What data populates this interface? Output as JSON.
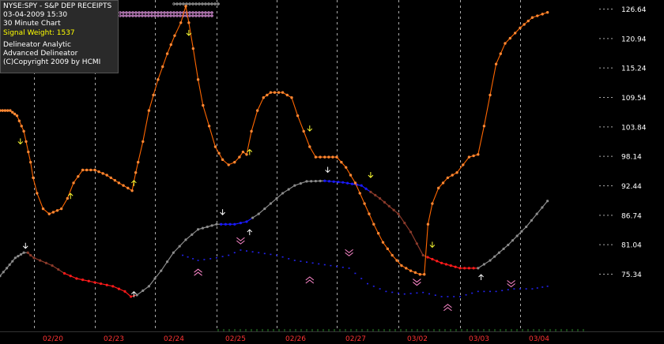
{
  "info_box": {
    "symbol_line": "NYSE:SPY - S&P DEP RECEIPTS",
    "datetime_line": "03-04-2009 15:30",
    "interval_line": "30 Minute Chart",
    "signal_line": "Signal Weight: 1537",
    "study_1": "Delineator Analytic",
    "study_2": "Advanced Delineator",
    "copyright": "(C)Copyright 2009 by HCMI"
  },
  "colors": {
    "background": "#000000",
    "price_line": "#ff6600",
    "price_dot": "#ff8833",
    "delineator_gray": "#8c8c8c",
    "delineator_brown": "#8b3a2a",
    "delineator_red": "#ff1a1a",
    "delineator_blue": "#1a1aff",
    "lower_band_blue": "#2222ee",
    "arrow_yellow": "#ffff33",
    "arrow_white": "#ffffff",
    "chevron_pink": "#ff88cc",
    "date_label": "#ff3333",
    "axis_label": "#ffffff",
    "grid_dash": "#aaaaaa"
  },
  "chart_data": {
    "type": "line",
    "x_axis": {
      "type": "time",
      "tick_labels": [
        "02/20",
        "02/23",
        "02/24",
        "02/25",
        "02/26",
        "02/27",
        "03/02",
        "03/03",
        "03/04"
      ]
    },
    "y_axis": {
      "tick_labels": [
        "126.64",
        "120.94",
        "115.24",
        "109.54",
        "103.84",
        "98.14",
        "92.44",
        "86.74",
        "81.04",
        "75.34"
      ],
      "range": [
        75.34,
        126.64
      ]
    },
    "grid": "dashed vertical day separators",
    "series": [
      {
        "style": "orange-dot-line",
        "points": [
          [
            0,
            107
          ],
          [
            0.3,
            107
          ],
          [
            0.5,
            106
          ],
          [
            0.7,
            103
          ],
          [
            0.9,
            97
          ],
          [
            1.05,
            91
          ],
          [
            1.15,
            88
          ],
          [
            1.25,
            87
          ],
          [
            1.45,
            88
          ],
          [
            1.55,
            90
          ],
          [
            1.65,
            93
          ],
          [
            1.8,
            95.5
          ],
          [
            2,
            95.5
          ],
          [
            2.2,
            94.5
          ],
          [
            2.4,
            93
          ],
          [
            2.55,
            92
          ],
          [
            2.62,
            91.5
          ],
          [
            2.68,
            95
          ],
          [
            2.72,
            97
          ],
          [
            2.8,
            101
          ],
          [
            2.9,
            107
          ],
          [
            3.05,
            113
          ],
          [
            3.2,
            118
          ],
          [
            3.32,
            121.5
          ],
          [
            3.42,
            124
          ],
          [
            3.5,
            127.2
          ],
          [
            3.55,
            124
          ],
          [
            3.62,
            119
          ],
          [
            3.7,
            113
          ],
          [
            3.78,
            108
          ],
          [
            3.88,
            104
          ],
          [
            3.98,
            100
          ],
          [
            4.1,
            97.5
          ],
          [
            4.2,
            96.5
          ],
          [
            4.3,
            97
          ],
          [
            4.38,
            98
          ],
          [
            4.44,
            99
          ],
          [
            4.5,
            98.5
          ],
          [
            4.58,
            103
          ],
          [
            4.68,
            107
          ],
          [
            4.78,
            109.5
          ],
          [
            4.9,
            110.5
          ],
          [
            5.1,
            110.5
          ],
          [
            5.25,
            109.5
          ],
          [
            5.35,
            106
          ],
          [
            5.45,
            103
          ],
          [
            5.55,
            100
          ],
          [
            5.65,
            98
          ],
          [
            5.8,
            98
          ],
          [
            6,
            98
          ],
          [
            6.15,
            96
          ],
          [
            6.3,
            93
          ],
          [
            6.45,
            89
          ],
          [
            6.6,
            85
          ],
          [
            6.75,
            81.5
          ],
          [
            6.9,
            79
          ],
          [
            7.05,
            77
          ],
          [
            7.2,
            76
          ],
          [
            7.35,
            75.3
          ],
          [
            7.42,
            75.3
          ],
          [
            7.48,
            85
          ],
          [
            7.55,
            89
          ],
          [
            7.65,
            92
          ],
          [
            7.8,
            94
          ],
          [
            7.95,
            95
          ],
          [
            8.05,
            96.5
          ],
          [
            8.15,
            98
          ],
          [
            8.3,
            98.5
          ],
          [
            8.4,
            104
          ],
          [
            8.5,
            110
          ],
          [
            8.6,
            116
          ],
          [
            8.75,
            120
          ],
          [
            9,
            123
          ],
          [
            9.2,
            125
          ],
          [
            9.45,
            126
          ]
        ]
      },
      {
        "style": "delineator-gray-line",
        "points": [
          [
            0,
            75
          ],
          [
            0.2,
            76.5
          ],
          [
            0.45,
            78.5
          ],
          [
            0.7,
            79.5
          ],
          [
            0.82,
            79.5
          ],
          [
            0.9,
            79
          ],
          [
            1.1,
            78
          ],
          [
            1.3,
            77
          ],
          [
            1.5,
            75.5
          ],
          [
            1.7,
            74.5
          ],
          [
            1.9,
            74
          ],
          [
            2.1,
            73.5
          ],
          [
            2.3,
            73
          ],
          [
            2.5,
            72
          ],
          [
            2.6,
            71
          ],
          [
            2.7,
            71.3
          ],
          [
            2.9,
            73
          ],
          [
            3.1,
            76
          ],
          [
            3.3,
            79.5
          ],
          [
            3.5,
            82
          ],
          [
            3.7,
            84
          ],
          [
            4.0,
            85
          ],
          [
            4.3,
            85
          ],
          [
            4.5,
            85.5
          ],
          [
            4.7,
            87
          ],
          [
            4.9,
            89
          ],
          [
            5.1,
            91
          ],
          [
            5.3,
            92.5
          ],
          [
            5.5,
            93.3
          ],
          [
            5.8,
            93.4
          ],
          [
            6.1,
            93.1
          ],
          [
            6.4,
            92.5
          ],
          [
            6.7,
            90
          ],
          [
            7,
            87
          ],
          [
            7.2,
            83.5
          ],
          [
            7.4,
            79
          ],
          [
            7.7,
            77.5
          ],
          [
            8,
            76.5
          ],
          [
            8.3,
            76.5
          ],
          [
            8.5,
            78
          ],
          [
            8.8,
            81
          ],
          [
            9.1,
            84.5
          ],
          [
            9.45,
            89.5
          ]
        ]
      },
      {
        "style": "lower-blue-band",
        "points": [
          [
            3.45,
            79
          ],
          [
            3.7,
            78
          ],
          [
            4.0,
            78.5
          ],
          [
            4.2,
            79
          ],
          [
            4.4,
            80
          ],
          [
            4.7,
            79.5
          ],
          [
            5.0,
            79
          ],
          [
            5.3,
            78
          ],
          [
            5.6,
            77.5
          ],
          [
            5.9,
            77
          ],
          [
            6.2,
            76.5
          ],
          [
            6.5,
            73.5
          ],
          [
            6.8,
            72
          ],
          [
            7.1,
            71.5
          ],
          [
            7.4,
            71.8
          ],
          [
            7.7,
            71
          ],
          [
            8.0,
            71
          ],
          [
            8.3,
            72
          ],
          [
            8.6,
            72
          ],
          [
            8.9,
            72.5
          ],
          [
            9.2,
            72.5
          ],
          [
            9.45,
            73
          ]
        ]
      }
    ],
    "signal_arrows": [
      {
        "x": 0.6,
        "y": 101,
        "dir": "down",
        "color": "yellow"
      },
      {
        "x": 1.6,
        "y": 90.5,
        "dir": "up",
        "color": "yellow"
      },
      {
        "x": 2.65,
        "y": 93,
        "dir": "up",
        "color": "yellow"
      },
      {
        "x": 3.55,
        "y": 122,
        "dir": "down",
        "color": "yellow"
      },
      {
        "x": 4.55,
        "y": 99,
        "dir": "up",
        "color": "yellow"
      },
      {
        "x": 5.55,
        "y": 103.5,
        "dir": "down",
        "color": "yellow"
      },
      {
        "x": 6.55,
        "y": 94.5,
        "dir": "down",
        "color": "yellow"
      },
      {
        "x": 7.55,
        "y": 81,
        "dir": "down",
        "color": "yellow"
      },
      {
        "x": 0.75,
        "y": 80.8,
        "dir": "down",
        "color": "white"
      },
      {
        "x": 2.65,
        "y": 71.5,
        "dir": "up",
        "color": "white"
      },
      {
        "x": 4.1,
        "y": 87.3,
        "dir": "down",
        "color": "white"
      },
      {
        "x": 4.55,
        "y": 83.5,
        "dir": "up",
        "color": "white"
      },
      {
        "x": 5.85,
        "y": 95.5,
        "dir": "down",
        "color": "white"
      },
      {
        "x": 8.35,
        "y": 74.8,
        "dir": "up",
        "color": "white"
      }
    ],
    "chevrons": [
      {
        "x": 3.7,
        "y": 76,
        "dir": "up"
      },
      {
        "x": 4.4,
        "y": 81.5,
        "dir": "down"
      },
      {
        "x": 5.55,
        "y": 74.5,
        "dir": "up"
      },
      {
        "x": 6.2,
        "y": 79.2,
        "dir": "down"
      },
      {
        "x": 7.3,
        "y": 73.5,
        "dir": "down"
      },
      {
        "x": 7.8,
        "y": 69.2,
        "dir": "up"
      },
      {
        "x": 8.85,
        "y": 73.2,
        "dir": "down"
      }
    ]
  }
}
